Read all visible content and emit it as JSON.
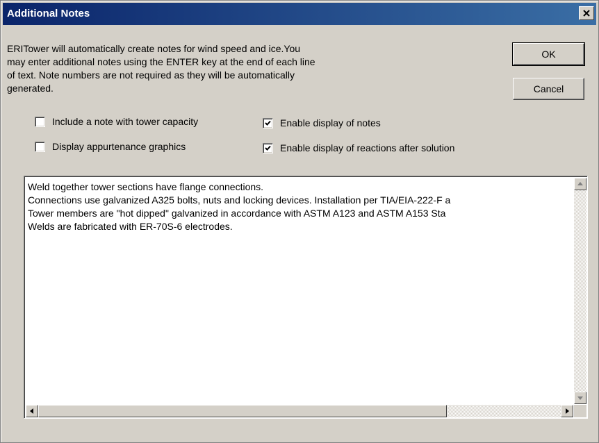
{
  "window": {
    "title": "Additional Notes"
  },
  "description": "ERITower will automatically create notes for wind speed and ice.You\nmay enter additional notes using  the ENTER key at the end of each line\nof text. Note numbers are not required as they will be automatically\ngenerated.",
  "buttons": {
    "ok": "OK",
    "cancel": "Cancel"
  },
  "options": [
    {
      "label": "Include a note with tower capacity",
      "checked": false
    },
    {
      "label": "Display appurtenance graphics",
      "checked": false
    },
    {
      "label": "Enable display of notes",
      "checked": true
    },
    {
      "label": "Enable display of reactions after solution",
      "checked": true
    }
  ],
  "notes_text": "Weld together tower sections have flange connections.\nConnections use galvanized A325 bolts, nuts and locking devices. Installation per TIA/EIA-222-F a\nTower members are \"hot dipped\" galvanized in accordance with ASTM A123 and ASTM A153 Sta\nWelds are fabricated with ER-70S-6 electrodes.",
  "colors": {
    "titlebar_start": "#0a246a",
    "titlebar_end": "#3a6ea5",
    "face": "#d4d0c8"
  },
  "icons": {
    "close": "close-icon",
    "check": "checkmark-icon",
    "arrow_up": "arrow-up-icon",
    "arrow_down": "arrow-down-icon",
    "arrow_left": "arrow-left-icon",
    "arrow_right": "arrow-right-icon"
  }
}
